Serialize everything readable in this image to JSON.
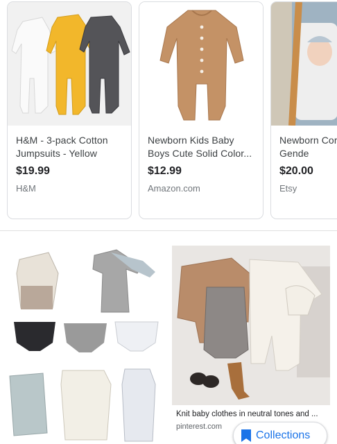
{
  "shopping_cards": [
    {
      "title": "H&M - 3-pack Cotton Jumpsuits - Yellow",
      "price": "$19.99",
      "store": "H&M"
    },
    {
      "title": "Newborn Kids Baby Boys Cute Solid Color...",
      "price": "$12.99",
      "store": "Amazon.com"
    },
    {
      "title": "Newborn Cor Outfit, Gende",
      "price": "$20.00",
      "store": "Etsy"
    }
  ],
  "image_results": [
    {
      "title": "Knit baby clothes in neutral tones and ...",
      "source": "pinterest.com"
    }
  ],
  "collections_button": {
    "label": "Collections",
    "icon": "bookmark-icon"
  },
  "colors": {
    "accent": "#1a73e8",
    "card_border": "#dadce0",
    "price": "#202124",
    "store": "#70757a"
  }
}
